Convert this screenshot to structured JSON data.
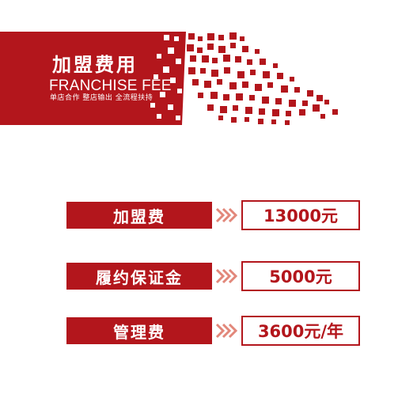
{
  "colors": {
    "primary": "#b3161c",
    "text_light": "#ffffff",
    "arrow": "#e2877a"
  },
  "banner": {
    "title": "加盟费用",
    "subtitle_en": "FRANCHISE FEE",
    "tagline": "单店合作 整店输出 全流程扶持"
  },
  "fees": [
    {
      "label": "加盟费",
      "value": "13000元"
    },
    {
      "label": "履约保证金",
      "value": "5000元"
    },
    {
      "label": "管理费",
      "value": "3600元/年"
    }
  ],
  "icons": {
    "arrow": "double-chevron-right-icon",
    "decoration": "pixel-scatter-decoration"
  }
}
